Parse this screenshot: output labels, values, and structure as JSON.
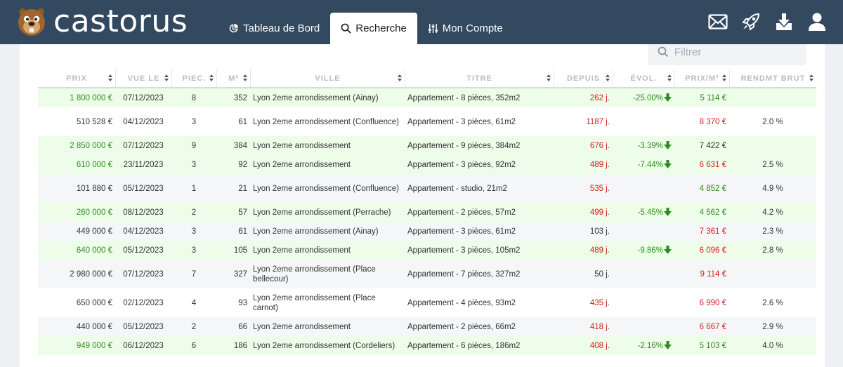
{
  "brand": {
    "name": "castorus"
  },
  "nav": {
    "tabs": [
      {
        "label": "Tableau de Bord",
        "icon": "pie-chart-icon",
        "active": false
      },
      {
        "label": "Recherche",
        "icon": "search-icon",
        "active": true
      },
      {
        "label": "Mon Compte",
        "icon": "sliders-icon",
        "active": false
      }
    ],
    "icons": [
      "mail-icon",
      "rocket-icon",
      "download-icon",
      "user-icon"
    ]
  },
  "filter": {
    "placeholder": "Filtrer"
  },
  "colors": {
    "nav_bg": "#33495f",
    "positive": "#2e8b1e",
    "negative": "#d42020",
    "row_highlight": "#eefdea"
  },
  "table": {
    "columns": [
      "PRIX",
      "VUE LE",
      "PIEC.",
      "M²",
      "VILLE",
      "TITRE",
      "DEPUIS",
      "ÉVOL.",
      "PRIX/M²",
      "RENDMT BRUT"
    ],
    "rows": [
      {
        "prix": "1 800 000 €",
        "vue": "07/12/2023",
        "pieces": "8",
        "m2": "352",
        "ville": "Lyon 2eme arrondissement (Ainay)",
        "titre": "Appartement - 8 pièces, 352m2",
        "depuis": "262 j.",
        "evol": "-25.00%",
        "prixm2": "5 114 €",
        "rendmt": "",
        "style": "green",
        "prix_c": "pos",
        "depuis_c": "neg",
        "prixm2_c": "pos",
        "tall": false
      },
      {
        "prix": "510 528 €",
        "vue": "04/12/2023",
        "pieces": "3",
        "m2": "61",
        "ville": "Lyon 2eme arrondissement (Confluence)",
        "titre": "Appartement - 3 pièces, 61m2",
        "depuis": "1187 j.",
        "evol": "",
        "prixm2": "8 370 €",
        "rendmt": "2.0 %",
        "style": "white",
        "prix_c": "neu",
        "depuis_c": "neg",
        "prixm2_c": "neg",
        "tall": true
      },
      {
        "prix": "2 850 000 €",
        "vue": "07/12/2023",
        "pieces": "9",
        "m2": "384",
        "ville": "Lyon 2eme arrondissement",
        "titre": "Appartement - 9 pièces, 384m2",
        "depuis": "676 j.",
        "evol": "-3.39%",
        "prixm2": "7 422 €",
        "rendmt": "",
        "style": "green",
        "prix_c": "pos",
        "depuis_c": "neg",
        "prixm2_c": "neu",
        "tall": false
      },
      {
        "prix": "610 000 €",
        "vue": "23/11/2023",
        "pieces": "3",
        "m2": "92",
        "ville": "Lyon 2eme arrondissement",
        "titre": "Appartement - 3 pièces, 92m2",
        "depuis": "489 j.",
        "evol": "-7.44%",
        "prixm2": "6 631 €",
        "rendmt": "2.5 %",
        "style": "green",
        "prix_c": "pos",
        "depuis_c": "neg",
        "prixm2_c": "neg",
        "tall": false
      },
      {
        "prix": "101 880 €",
        "vue": "05/12/2023",
        "pieces": "1",
        "m2": "21",
        "ville": "Lyon 2eme arrondissement (Confluence)",
        "titre": "Appartement - studio, 21m2",
        "depuis": "535 j.",
        "evol": "",
        "prixm2": "4 852 €",
        "rendmt": "4.9 %",
        "style": "gray",
        "prix_c": "neu",
        "depuis_c": "neg",
        "prixm2_c": "pos",
        "tall": true
      },
      {
        "prix": "260 000 €",
        "vue": "08/12/2023",
        "pieces": "2",
        "m2": "57",
        "ville": "Lyon 2eme arrondissement (Perrache)",
        "titre": "Appartement - 2 pièces, 57m2",
        "depuis": "499 j.",
        "evol": "-5.45%",
        "prixm2": "4 562 €",
        "rendmt": "4.2 %",
        "style": "green",
        "prix_c": "pos",
        "depuis_c": "neg",
        "prixm2_c": "pos",
        "tall": false
      },
      {
        "prix": "449 000 €",
        "vue": "04/12/2023",
        "pieces": "3",
        "m2": "61",
        "ville": "Lyon 2eme arrondissement (Ainay)",
        "titre": "Appartement - 3 pièces, 61m2",
        "depuis": "103 j.",
        "evol": "",
        "prixm2": "7 361 €",
        "rendmt": "2.3 %",
        "style": "gray",
        "prix_c": "neu",
        "depuis_c": "neu",
        "prixm2_c": "neg",
        "tall": false
      },
      {
        "prix": "640 000 €",
        "vue": "05/12/2023",
        "pieces": "3",
        "m2": "105",
        "ville": "Lyon 2eme arrondissement",
        "titre": "Appartement - 3 pièces, 105m2",
        "depuis": "489 j.",
        "evol": "-9.86%",
        "prixm2": "6 096 €",
        "rendmt": "2.8 %",
        "style": "green",
        "prix_c": "pos",
        "depuis_c": "neg",
        "prixm2_c": "neg",
        "tall": false
      },
      {
        "prix": "2 980 000 €",
        "vue": "07/12/2023",
        "pieces": "7",
        "m2": "327",
        "ville": "Lyon 2eme arrondissement (Place bellecour)",
        "titre": "Appartement - 7 pièces, 327m2",
        "depuis": "50 j.",
        "evol": "",
        "prixm2": "9 114 €",
        "rendmt": "",
        "style": "gray",
        "prix_c": "neu",
        "depuis_c": "neu",
        "prixm2_c": "neg",
        "tall": true
      },
      {
        "prix": "650 000 €",
        "vue": "02/12/2023",
        "pieces": "4",
        "m2": "93",
        "ville": "Lyon 2eme arrondissement (Place carnot)",
        "titre": "Appartement - 4 pièces, 93m2",
        "depuis": "435 j.",
        "evol": "",
        "prixm2": "6 990 €",
        "rendmt": "2.6 %",
        "style": "white",
        "prix_c": "neu",
        "depuis_c": "neg",
        "prixm2_c": "neg",
        "tall": true
      },
      {
        "prix": "440 000 €",
        "vue": "05/12/2023",
        "pieces": "2",
        "m2": "66",
        "ville": "Lyon 2eme arrondissement",
        "titre": "Appartement - 2 pièces, 66m2",
        "depuis": "418 j.",
        "evol": "",
        "prixm2": "6 667 €",
        "rendmt": "2.9 %",
        "style": "gray",
        "prix_c": "neu",
        "depuis_c": "neg",
        "prixm2_c": "neg",
        "tall": false
      },
      {
        "prix": "949 000 €",
        "vue": "06/12/2023",
        "pieces": "6",
        "m2": "186",
        "ville": "Lyon 2eme arrondissement (Cordeliers)",
        "titre": "Appartement - 6 pièces, 186m2",
        "depuis": "408 j.",
        "evol": "-2.16%",
        "prixm2": "5 103 €",
        "rendmt": "4.0 %",
        "style": "green",
        "prix_c": "pos",
        "depuis_c": "neg",
        "prixm2_c": "pos",
        "tall": false
      }
    ]
  }
}
